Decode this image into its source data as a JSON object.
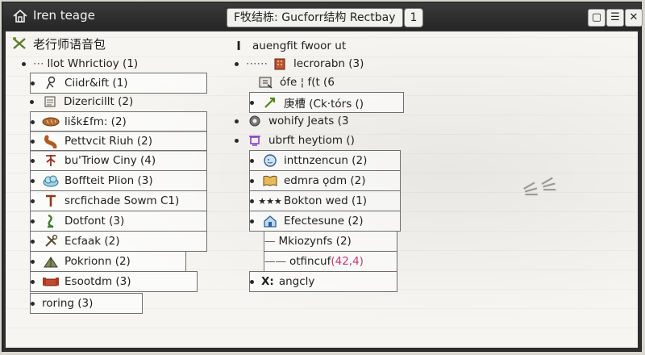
{
  "window": {
    "title": "Iren teage",
    "center_title": "F牧结栋: Gucforr结构 Rectbay",
    "count": "1",
    "btn_min": "▢",
    "btn_max": "☰",
    "btn_close": "✕"
  },
  "left": {
    "header": "老行师语音包",
    "parent": "llot Whrictioy (1)",
    "items": [
      {
        "label": "Ciidr&ift (1)",
        "icon": "stick-figure-icon"
      },
      {
        "label": "Dizericillt (2)",
        "icon": "scroll-icon"
      },
      {
        "label": "lišk£fm: (2)",
        "icon": "bread-icon"
      },
      {
        "label": "Pettvcit Riuh (2)",
        "icon": "sausage-icon"
      },
      {
        "label": "bu'Triow Ciny (4)",
        "icon": "branch-icon"
      },
      {
        "label": "Boffteit Plion (3)",
        "icon": "cloud-icon"
      },
      {
        "label": "srcfichade Sowm C1)",
        "icon": "pillar-icon"
      },
      {
        "label": "Dotfont (3)",
        "icon": "dragon-icon"
      },
      {
        "label": "Ecfaak (2)",
        "icon": "tools-icon"
      },
      {
        "label": "Pokrionn (2)",
        "icon": "tent-icon"
      },
      {
        "label": "Esootdm (3)",
        "icon": "sofa-icon"
      },
      {
        "label": "roring (3)",
        "icon": "none"
      }
    ]
  },
  "right": {
    "header": "auengfit fwoor ut",
    "header_icon": "I",
    "items": [
      {
        "label": "lecrorabn (3)"
      },
      {
        "label": "ófe ¦ f(t (6"
      },
      {
        "label": "庚槽 (Ck·tórs ()"
      },
      {
        "label": "wohify Jeats (3"
      },
      {
        "label": "ubrft heytiom ()"
      },
      {
        "label": "inttnzencun (2)"
      },
      {
        "label": "edmra ǫdm (2)"
      },
      {
        "label": "Bokton wed (1)"
      },
      {
        "label": "Efectesune (2)"
      },
      {
        "label": "Mkiozynfs (2)"
      },
      {
        "label": "otfincuf",
        "value": "(42,4)"
      },
      {
        "label": "angcly",
        "prefix": "X:"
      }
    ]
  }
}
